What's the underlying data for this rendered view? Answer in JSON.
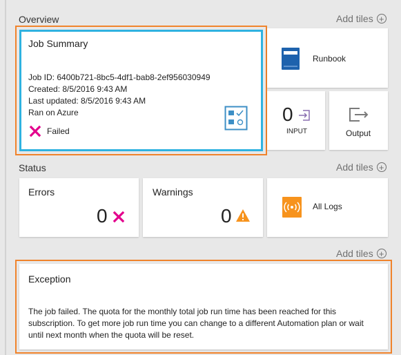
{
  "overview": {
    "title": "Overview",
    "add_tiles": "Add tiles",
    "job_summary": {
      "title": "Job Summary",
      "job_id": "Job ID: 6400b721-8bc5-4df1-bab8-2ef956030949",
      "created": "Created: 8/5/2016 9:43 AM",
      "last_updated": "Last updated: 8/5/2016 9:43 AM",
      "ran_on": "Ran on Azure",
      "status": "Failed"
    },
    "runbook": {
      "label": "Runbook"
    },
    "input": {
      "count": "0",
      "label": "INPUT"
    },
    "output": {
      "label": "Output"
    }
  },
  "status": {
    "title": "Status",
    "add_tiles": "Add tiles",
    "errors": {
      "label": "Errors",
      "count": "0"
    },
    "warnings": {
      "label": "Warnings",
      "count": "0"
    },
    "all_logs": {
      "label": "All Logs"
    }
  },
  "exception": {
    "add_tiles": "Add tiles",
    "title": "Exception",
    "message": "The job failed. The quota for the monthly total job run time has been reached for this subscription. To get more job run time you can change to a different Automation plan or wait until next month when the quota will be reset."
  },
  "colors": {
    "highlight_orange": "#f0832b",
    "selection_blue": "#2fb2e0",
    "failed_magenta": "#e3008c",
    "runbook_blue": "#1e62ad",
    "warning_orange": "#f7931d"
  }
}
